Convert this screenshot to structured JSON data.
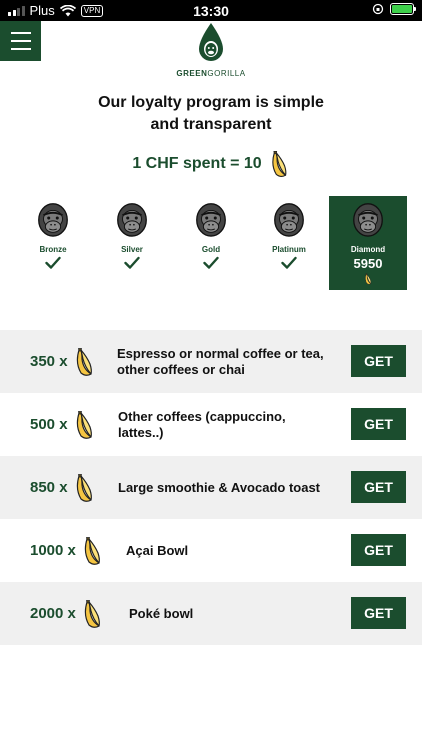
{
  "status_bar": {
    "carrier": "Plus",
    "vpn": "VPN",
    "time": "13:30"
  },
  "logo": {
    "text_bold": "GREEN",
    "text_light": "GORILLA"
  },
  "headline": {
    "line1": "Our loyalty program is simple",
    "line2": "and transparent"
  },
  "rate": {
    "text": "1 CHF spent = 10"
  },
  "tiers": [
    {
      "name": "Bronze"
    },
    {
      "name": "Silver"
    },
    {
      "name": "Gold"
    },
    {
      "name": "Platinum"
    },
    {
      "name": "Diamond",
      "points": "5950"
    }
  ],
  "rewards": [
    {
      "cost": "350 x",
      "desc": "Espresso or normal coffee or tea, other coffees or chai",
      "button": "GET"
    },
    {
      "cost": "500 x",
      "desc": "Other coffees (cappuccino, lattes..)",
      "button": "GET"
    },
    {
      "cost": "850 x",
      "desc": "Large smoothie & Avocado toast",
      "button": "GET"
    },
    {
      "cost": "1000 x",
      "desc": "Açai Bowl",
      "button": "GET"
    },
    {
      "cost": "2000 x",
      "desc": "Poké bowl",
      "button": "GET"
    }
  ],
  "colors": {
    "brand_green": "#1b4d2e",
    "row_shade": "#f0f0f0",
    "banana_yellow": "#f5c542"
  }
}
